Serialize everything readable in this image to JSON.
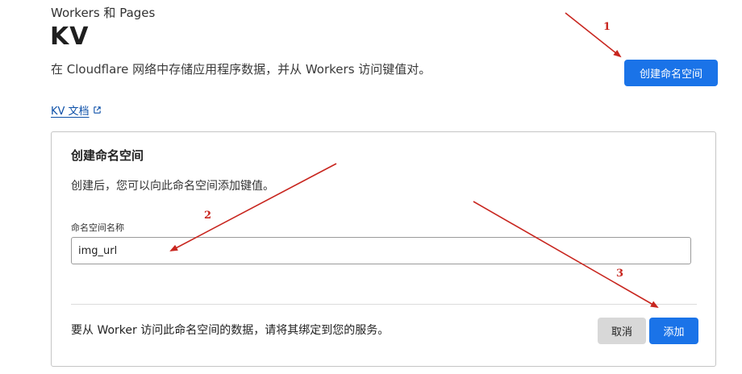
{
  "header": {
    "breadcrumb": "Workers 和 Pages",
    "title": "KV",
    "description": "在 Cloudflare 网络中存储应用程序数据，并从 Workers 访问键值对。",
    "create_button": "创建命名空间",
    "docs_link": "KV 文档"
  },
  "card": {
    "title": "创建命名空间",
    "description": "创建后，您可以向此命名空间添加键值。",
    "field_label": "命名空间名称",
    "input_value": "img_url",
    "footer_text": "要从 Worker 访问此命名空间的数据，请将其绑定到您的服务。",
    "cancel_button": "取消",
    "add_button": "添加"
  },
  "annotations": {
    "labels": [
      "1",
      "2",
      "3"
    ],
    "color": "#c8261f"
  },
  "colors": {
    "primary": "#1a73e8",
    "link": "#0b4fa8",
    "cancel_bg": "#d8d8d8"
  },
  "icons": {
    "docs_link_icon": "external-link-icon"
  }
}
